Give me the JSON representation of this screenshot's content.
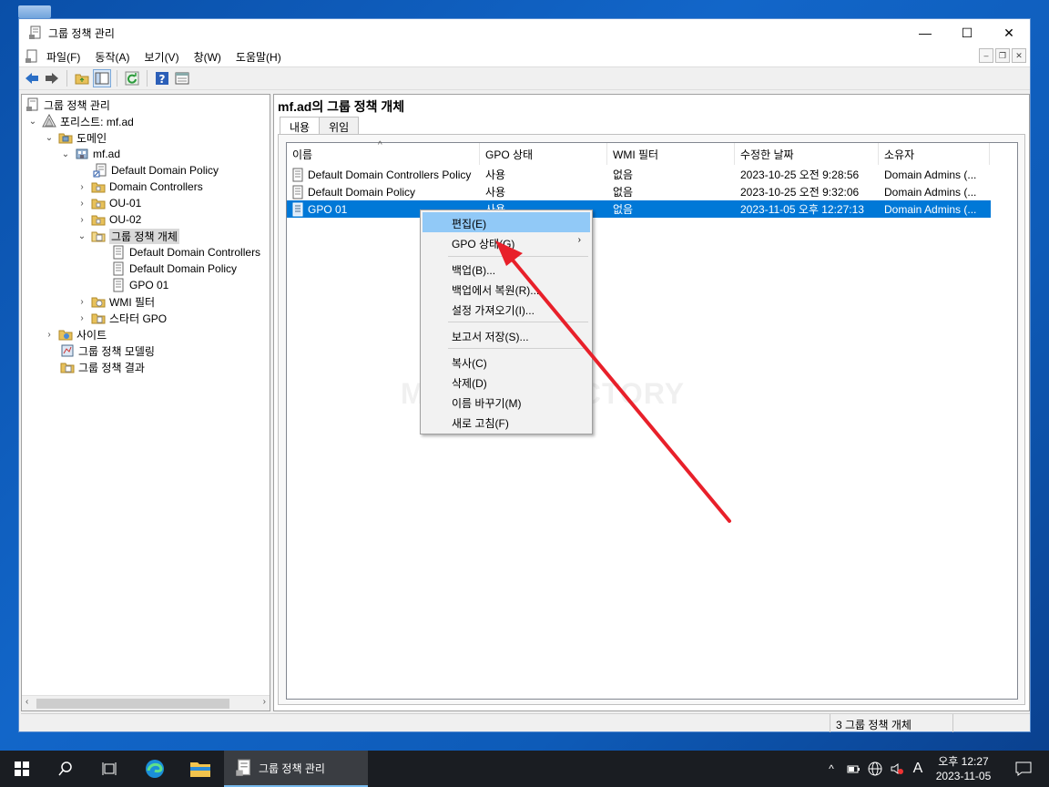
{
  "window": {
    "title": "그룹 정책 관리",
    "controls": {
      "minimize": "—",
      "maximize": "☐",
      "close": "✕"
    }
  },
  "menu": [
    "파일(F)",
    "동작(A)",
    "보기(V)",
    "창(W)",
    "도움말(H)"
  ],
  "tree": {
    "root": "그룹 정책 관리",
    "forest": "포리스트: mf.ad",
    "domains": "도메인",
    "domain": "mf.ad",
    "ddp": "Default Domain Policy",
    "dc": "Domain Controllers",
    "ou1": "OU-01",
    "ou2": "OU-02",
    "gpo_container": "그룹 정책 개체",
    "gpo_ddcp": "Default Domain Controllers",
    "gpo_ddp": "Default Domain Policy",
    "gpo_01": "GPO 01",
    "wmi": "WMI 필터",
    "starter": "스타터 GPO",
    "sites": "사이트",
    "modeling": "그룹 정책 모델링",
    "results": "그룹 정책 결과"
  },
  "right": {
    "header": "mf.ad의 그룹 정책 개체",
    "tabs": [
      "내용",
      "위임"
    ],
    "columns": [
      "이름",
      "GPO 상태",
      "WMI 필터",
      "수정한 날짜",
      "소유자"
    ],
    "rows": [
      {
        "name": "Default Domain Controllers Policy",
        "status": "사용",
        "wmi": "없음",
        "modified": "2023-10-25 오전 9:28:56",
        "owner": "Domain Admins (..."
      },
      {
        "name": "Default Domain Policy",
        "status": "사용",
        "wmi": "없음",
        "modified": "2023-10-25 오전 9:32:06",
        "owner": "Domain Admins (..."
      },
      {
        "name": "GPO 01",
        "status": "사용",
        "wmi": "없음",
        "modified": "2023-11-05 오후 12:27:13",
        "owner": "Domain Admins (..."
      }
    ]
  },
  "context_menu": {
    "edit": "편집(E)",
    "gpo_status": "GPO 상태(G)",
    "backup": "백업(B)...",
    "restore": "백업에서 복원(R)...",
    "import": "설정 가져오기(I)...",
    "save_report": "보고서 저장(S)...",
    "copy": "복사(C)",
    "delete": "삭제(D)",
    "rename": "이름 바꾸기(M)",
    "refresh": "새로 고침(F)"
  },
  "watermark": "MANUAL FACTORY",
  "status": "3 그룹 정책 개체",
  "taskbar": {
    "app_label": "그룹 정책 관리",
    "time": "오후 12:27",
    "date": "2023-11-05",
    "ime": "A"
  },
  "colors": {
    "selection": "#0078d7",
    "menu_highlight": "#91c9f7",
    "annotation": "#e8202a"
  }
}
